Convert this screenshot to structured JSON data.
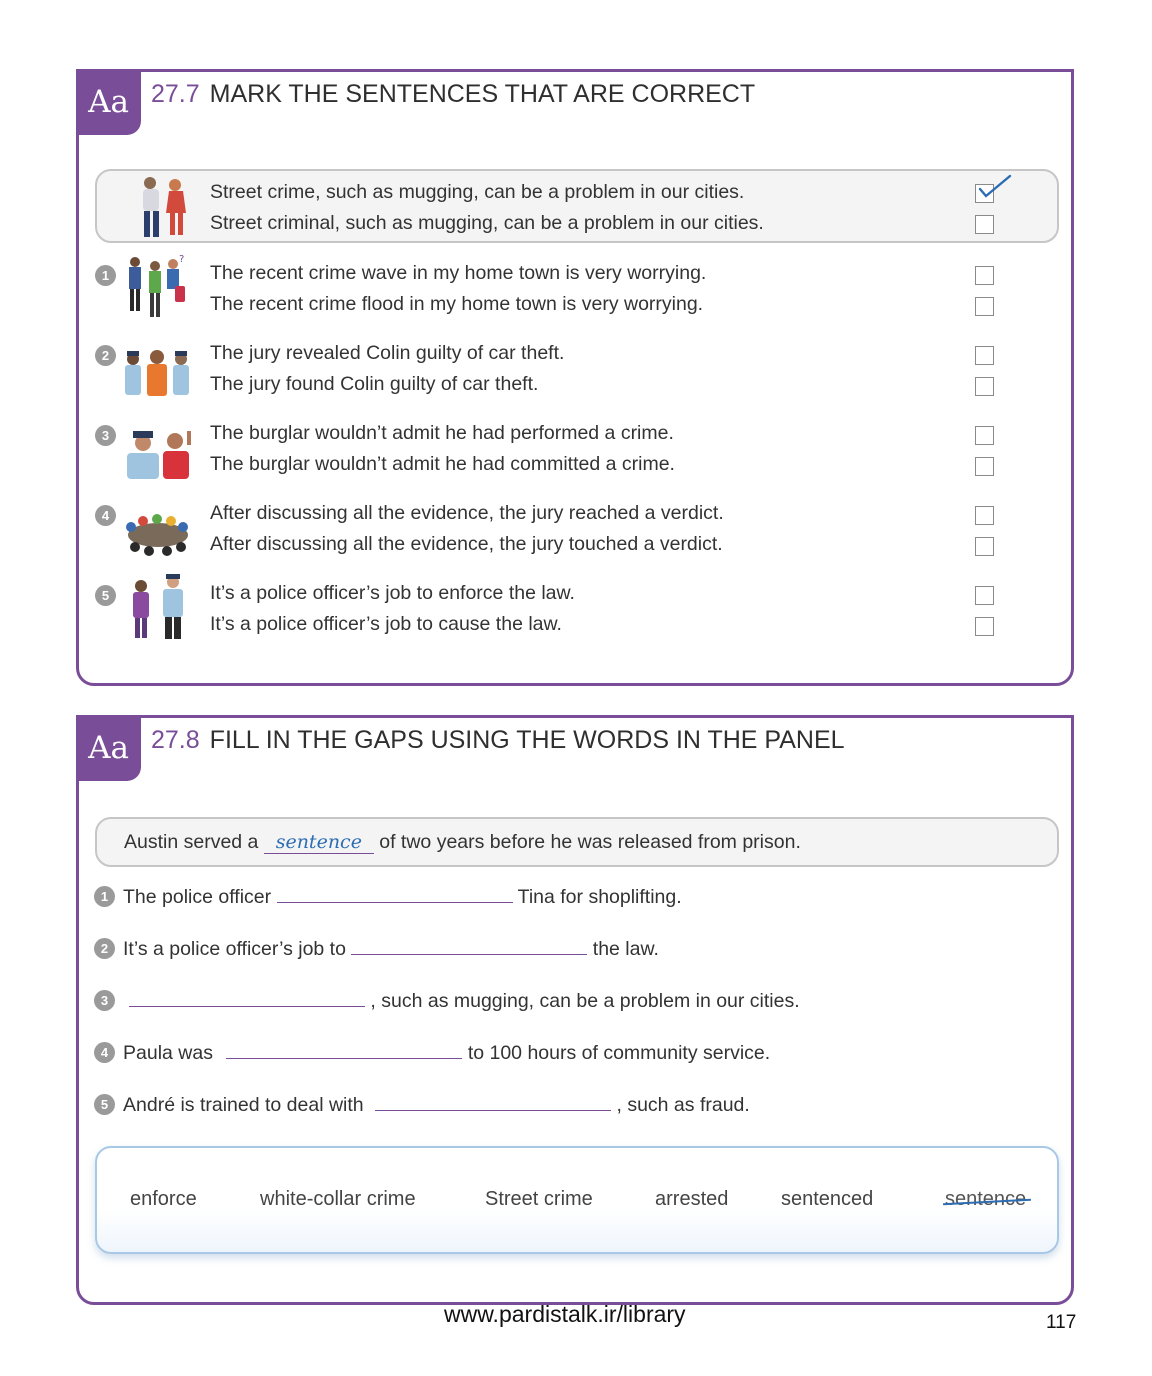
{
  "ex1": {
    "badge": "Aa",
    "number": "27.7",
    "title": "MARK THE SENTENCES THAT ARE CORRECT",
    "example": {
      "sentences": [
        "Street crime, such as mugging, can be a problem in our cities.",
        "Street criminal, such as mugging, can be a problem in our cities."
      ],
      "checked_index": 0
    },
    "items": [
      {
        "num": "1",
        "sentences": [
          "The recent crime wave in my home town is very worrying.",
          "The recent crime flood in my home town is very worrying."
        ]
      },
      {
        "num": "2",
        "sentences": [
          "The jury revealed Colin guilty of car theft.",
          "The jury found Colin guilty of car theft."
        ]
      },
      {
        "num": "3",
        "sentences": [
          "The burglar wouldn’t admit he had performed a crime.",
          "The burglar wouldn’t admit he had committed a crime."
        ]
      },
      {
        "num": "4",
        "sentences": [
          "After discussing all the evidence, the jury reached a verdict.",
          "After discussing all the evidence, the jury touched a verdict."
        ]
      },
      {
        "num": "5",
        "sentences": [
          "It’s a police officer’s job to enforce the law.",
          "It’s a police officer’s job to cause the law."
        ]
      }
    ]
  },
  "ex2": {
    "badge": "Aa",
    "number": "27.8",
    "title": "FILL IN THE GAPS USING THE WORDS IN THE PANEL",
    "example": {
      "before": "Austin served a",
      "answer": "sentence",
      "after": "of two years before he was released from prison."
    },
    "items": [
      {
        "num": "1",
        "before": "The police officer",
        "after": "Tina for shoplifting."
      },
      {
        "num": "2",
        "before": "It’s a police officer’s job to",
        "after": "the law."
      },
      {
        "num": "3",
        "before": "",
        "after": ", such as mugging, can be a problem in our cities."
      },
      {
        "num": "4",
        "before": "Paula was",
        "after": "to 100 hours of community service."
      },
      {
        "num": "5",
        "before": "André is trained to deal with",
        "after": ", such as fraud."
      }
    ],
    "word_panel": [
      "enforce",
      "white-collar crime",
      "Street crime",
      "arrested",
      "sentenced",
      "sentence"
    ],
    "used_word": "sentence"
  },
  "footer": {
    "url": "www.pardistalk.ir/library",
    "page_number": "117"
  },
  "colors": {
    "accent": "#7a4d98",
    "handwriting": "#2c6db3"
  }
}
